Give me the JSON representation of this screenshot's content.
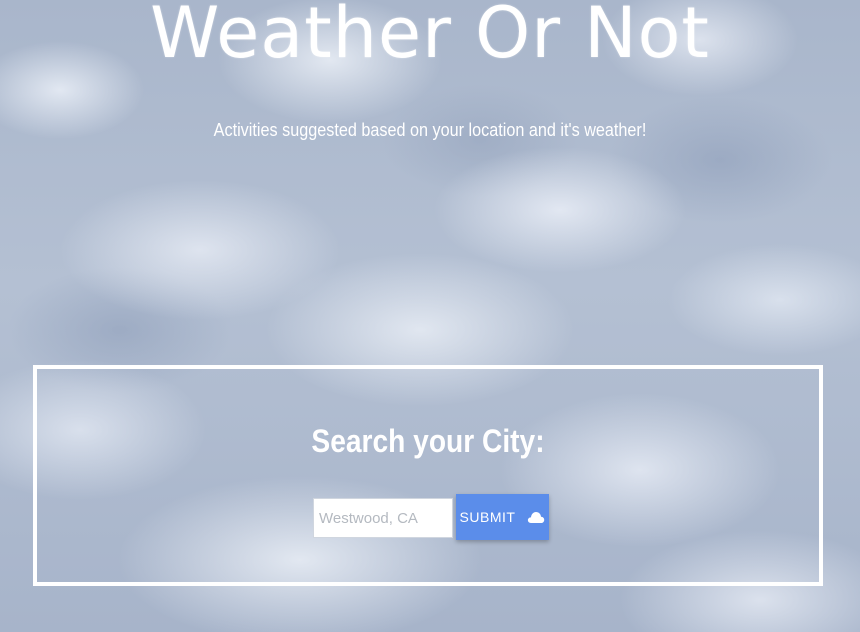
{
  "header": {
    "title": "Weather Or Not",
    "subtitle": "Activities suggested based on your location and it's weather!"
  },
  "search": {
    "heading": "Search your City:",
    "placeholder": "Westwood, CA",
    "value": "",
    "submit_label": "SUBMIT",
    "submit_icon": "cloud-icon"
  },
  "colors": {
    "accent": "#5b8dea",
    "text": "#ffffff",
    "border": "#ffffff"
  }
}
